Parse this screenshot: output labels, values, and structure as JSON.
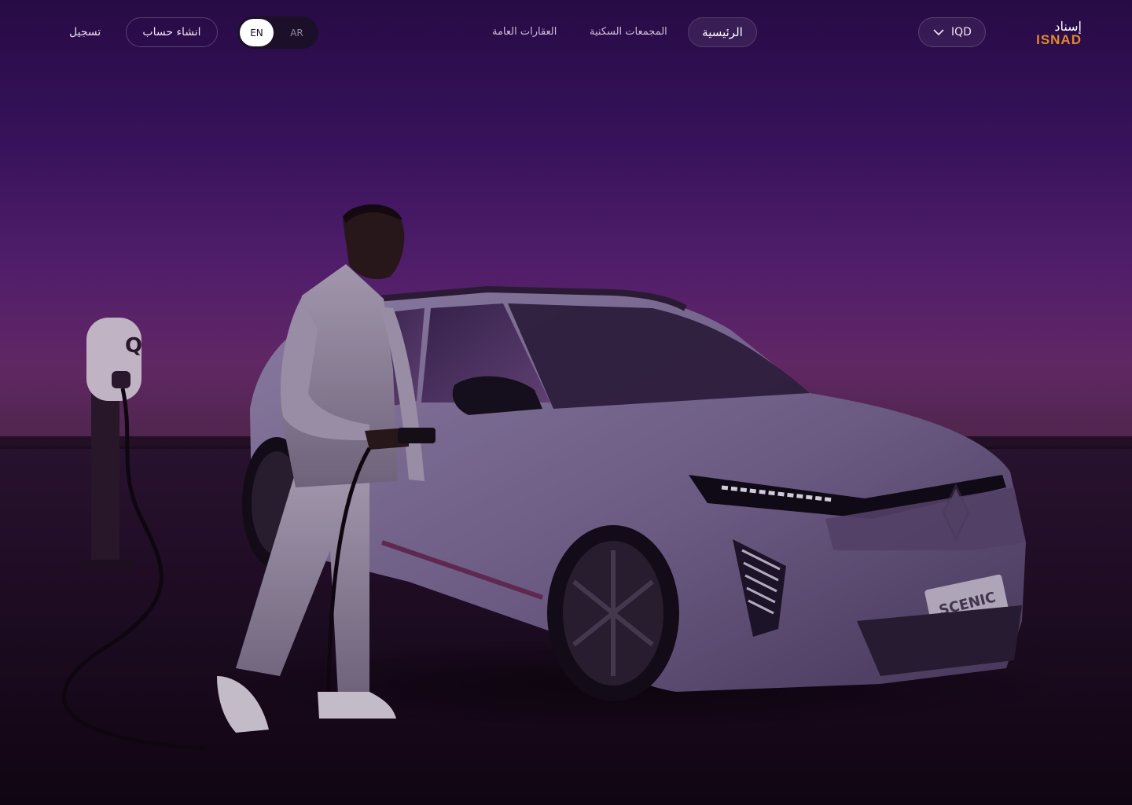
{
  "header": {
    "logo": {
      "arabic": "إسناد",
      "latin": "ISNAD"
    },
    "currency": {
      "value": "IQD",
      "icon": "chevron-down-icon"
    },
    "nav": [
      {
        "label": "الرئيسية",
        "active": true
      },
      {
        "label": "المجمعات السكنية",
        "active": false
      },
      {
        "label": "العقارات العامة",
        "active": false
      }
    ],
    "language": {
      "options": [
        "EN",
        "AR"
      ],
      "selected": "EN"
    },
    "create_account_label": "انشاء حساب",
    "login_label": "تسجيل"
  },
  "hero": {
    "car_badge": "SCENIC",
    "charger_icon": "ev-charger-icon"
  },
  "colors": {
    "accent_orange": "#e08a2c",
    "background_top": "#2a0c4a",
    "background_glow": "#6d2d6f"
  }
}
